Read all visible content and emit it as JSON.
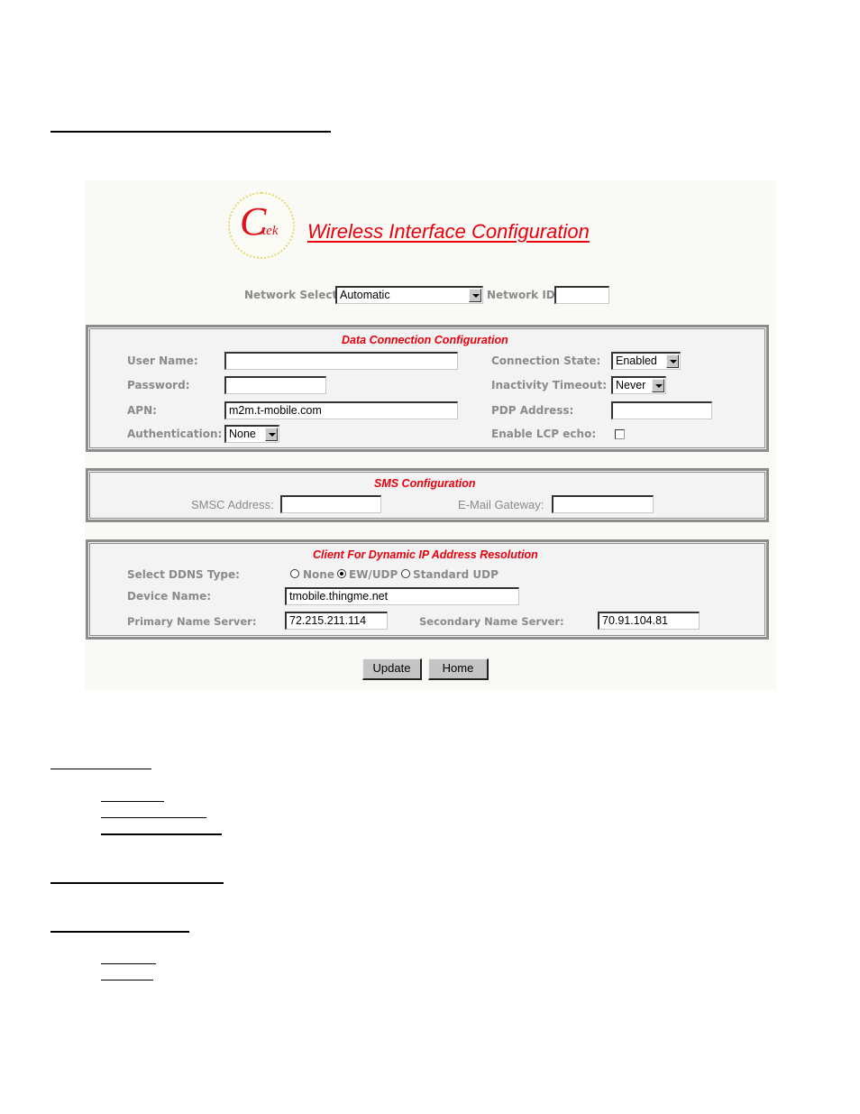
{
  "page": {
    "heading_link": "",
    "lower_links": [
      {
        "level": "heading",
        "text": ""
      },
      {
        "level": "item",
        "text": ""
      },
      {
        "level": "item",
        "text": ""
      },
      {
        "level": "item",
        "text": ""
      },
      {
        "level": "heading",
        "text": ""
      },
      {
        "level": "heading",
        "text": ""
      },
      {
        "level": "item",
        "text": ""
      },
      {
        "level": "item",
        "text": ""
      }
    ]
  },
  "app": {
    "logo": {
      "letter": "C",
      "suffix": "tek"
    },
    "title": "Wireless Interface Configuration",
    "accent_color": "#e8000c"
  },
  "network": {
    "select_label": "Network Select:",
    "select_value": "Automatic",
    "id_label": "Network ID:",
    "id_value": ""
  },
  "data_connection": {
    "title": "Data Connection Configuration",
    "user_name": {
      "label": "User Name:",
      "value": ""
    },
    "password": {
      "label": "Password:",
      "value": ""
    },
    "apn": {
      "label": "APN:",
      "value": "m2m.t-mobile.com"
    },
    "authentication": {
      "label": "Authentication:",
      "value": "None"
    },
    "connection_state": {
      "label": "Connection State:",
      "value": "Enabled"
    },
    "inactivity_timeout": {
      "label": "Inactivity Timeout:",
      "value": "Never"
    },
    "pdp_address": {
      "label": "PDP Address:",
      "value": ""
    },
    "lcp_echo": {
      "label": "Enable LCP echo:",
      "checked": false
    }
  },
  "sms": {
    "title": "SMS Configuration",
    "smsc": {
      "label": "SMSC Address:",
      "value": ""
    },
    "email_gateway": {
      "label": "E-Mail Gateway:",
      "value": ""
    }
  },
  "ddns": {
    "title": "Client For Dynamic IP Address Resolution",
    "type_label": "Select DDNS Type:",
    "options": [
      {
        "label": "None",
        "selected": false
      },
      {
        "label": "EW/UDP",
        "selected": true
      },
      {
        "label": "Standard UDP",
        "selected": false
      }
    ],
    "device_name": {
      "label": "Device Name:",
      "value": "tmobile.thingme.net"
    },
    "primary_ns": {
      "label": "Primary Name Server:",
      "value": "72.215.211.114"
    },
    "secondary_ns": {
      "label": "Secondary Name Server:",
      "value": "70.91.104.81"
    }
  },
  "buttons": {
    "update": "Update",
    "home": "Home"
  }
}
